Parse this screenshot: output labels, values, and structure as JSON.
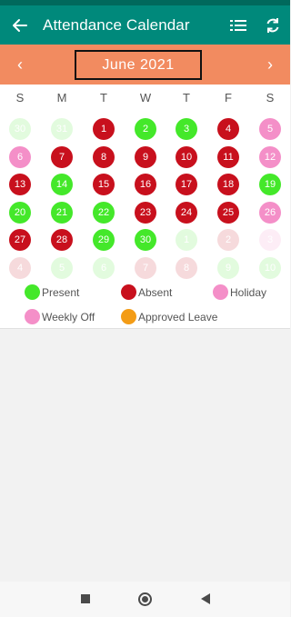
{
  "appbar": {
    "title": "Attendance Calendar",
    "back_icon": "arrow-left-icon",
    "list_icon": "list-icon",
    "refresh_icon": "refresh-icon",
    "background": "#00897b"
  },
  "month_nav": {
    "label": "June  2021",
    "prev_label": "‹",
    "next_label": "›",
    "background": "#f28b60"
  },
  "weekdays": [
    "S",
    "M",
    "T",
    "W",
    "T",
    "F",
    "S"
  ],
  "status_colors": {
    "present": "#44e82a",
    "absent": "#c8101d",
    "holiday": "#f48fc8",
    "weekly_off": "#f48fc8",
    "approved_leave": "#f39c16"
  },
  "calendar_days": [
    {
      "day": "30",
      "status": "present",
      "current_month": false
    },
    {
      "day": "31",
      "status": "present",
      "current_month": false
    },
    {
      "day": "1",
      "status": "absent",
      "current_month": true
    },
    {
      "day": "2",
      "status": "present",
      "current_month": true
    },
    {
      "day": "3",
      "status": "present",
      "current_month": true
    },
    {
      "day": "4",
      "status": "absent",
      "current_month": true
    },
    {
      "day": "5",
      "status": "weekly_off",
      "current_month": true
    },
    {
      "day": "6",
      "status": "weekly_off",
      "current_month": true
    },
    {
      "day": "7",
      "status": "absent",
      "current_month": true
    },
    {
      "day": "8",
      "status": "absent",
      "current_month": true
    },
    {
      "day": "9",
      "status": "absent",
      "current_month": true
    },
    {
      "day": "10",
      "status": "absent",
      "current_month": true
    },
    {
      "day": "11",
      "status": "absent",
      "current_month": true
    },
    {
      "day": "12",
      "status": "weekly_off",
      "current_month": true
    },
    {
      "day": "13",
      "status": "absent",
      "current_month": true
    },
    {
      "day": "14",
      "status": "present",
      "current_month": true
    },
    {
      "day": "15",
      "status": "absent",
      "current_month": true
    },
    {
      "day": "16",
      "status": "absent",
      "current_month": true
    },
    {
      "day": "17",
      "status": "absent",
      "current_month": true
    },
    {
      "day": "18",
      "status": "absent",
      "current_month": true
    },
    {
      "day": "19",
      "status": "present",
      "current_month": true
    },
    {
      "day": "20",
      "status": "present",
      "current_month": true
    },
    {
      "day": "21",
      "status": "present",
      "current_month": true
    },
    {
      "day": "22",
      "status": "present",
      "current_month": true
    },
    {
      "day": "23",
      "status": "absent",
      "current_month": true
    },
    {
      "day": "24",
      "status": "absent",
      "current_month": true
    },
    {
      "day": "25",
      "status": "absent",
      "current_month": true
    },
    {
      "day": "26",
      "status": "weekly_off",
      "current_month": true
    },
    {
      "day": "27",
      "status": "absent",
      "current_month": true
    },
    {
      "day": "28",
      "status": "absent",
      "current_month": true
    },
    {
      "day": "29",
      "status": "present",
      "current_month": true
    },
    {
      "day": "30",
      "status": "present",
      "current_month": true
    },
    {
      "day": "1",
      "status": "present",
      "current_month": false
    },
    {
      "day": "2",
      "status": "absent",
      "current_month": false
    },
    {
      "day": "3",
      "status": "weekly_off",
      "current_month": false
    },
    {
      "day": "4",
      "status": "absent",
      "current_month": false
    },
    {
      "day": "5",
      "status": "present",
      "current_month": false
    },
    {
      "day": "6",
      "status": "present",
      "current_month": false
    },
    {
      "day": "7",
      "status": "absent",
      "current_month": false
    },
    {
      "day": "8",
      "status": "absent",
      "current_month": false
    },
    {
      "day": "9",
      "status": "present",
      "current_month": false
    },
    {
      "day": "10",
      "status": "present",
      "current_month": false
    }
  ],
  "legend": [
    {
      "label": "Present",
      "status": "present"
    },
    {
      "label": "Absent",
      "status": "absent"
    },
    {
      "label": "Holiday",
      "status": "holiday"
    },
    {
      "label": "Weekly Off",
      "status": "weekly_off"
    },
    {
      "label": "Approved Leave",
      "status": "approved_leave"
    }
  ],
  "system_nav": {
    "recents_icon": "square-icon",
    "home_icon": "circle-home-icon",
    "back_icon": "triangle-back-icon"
  }
}
